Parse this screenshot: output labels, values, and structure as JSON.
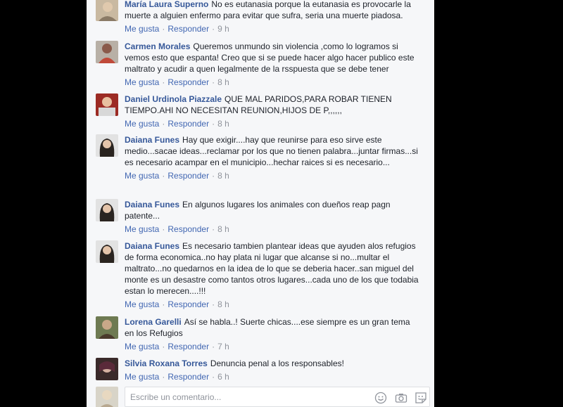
{
  "comments": [
    {
      "author": "María Laura Superno",
      "text": "No es eutanasia porque la eutanasia es provocarle la muerte a alguien enfermo para evitar que sufra, seria una muerte piadosa.",
      "like": "Me gusta",
      "reply": "Responder",
      "time": "9 h"
    },
    {
      "author": "Carmen Morales",
      "text": "Queremos unmundo sin violencia ,como lo logramos si vemos esto que espanta! Creo que si se puede hacer algo hacer publico este maltrato y acudir a quen legalmente de la rsspuesta que se debe tener",
      "like": "Me gusta",
      "reply": "Responder",
      "time": "8 h"
    },
    {
      "author": "Daniel Urdinola Piazzale",
      "text": "QUE MAL PARIDOS,PARA ROBAR TIENEN TIEMPO.AHI NO NECESITAN REUNION,HIJOS DE P,,,,,,",
      "like": "Me gusta",
      "reply": "Responder",
      "time": "8 h"
    },
    {
      "author": "Daiana Funes",
      "text": "Hay que exigir....hay que reunirse para eso sirve este medio...sacae ideas...reclamar por los que no tienen palabra...juntar firmas...si es necesario acampar en el municipio...hechar raices si es necesario...",
      "like": "Me gusta",
      "reply": "Responder",
      "time": "8 h"
    },
    {
      "author": "Daiana Funes",
      "text": "En algunos lugares los animales con dueños reap pagn patente...",
      "like": "Me gusta",
      "reply": "Responder",
      "time": "8 h"
    },
    {
      "author": "Daiana Funes",
      "text": "Es necesario tambien plantear ideas que ayuden alos refugios de forma economica..no hay plata ni lugar que alcanse si no...multar el maltrato...no quedarnos en la idea de lo que se deberia hacer..san miguel del monte es un desastre como tantos otros lugares...cada uno de los que todabia estan lo merecen....!!!",
      "like": "Me gusta",
      "reply": "Responder",
      "time": "8 h"
    },
    {
      "author": "Lorena Garelli",
      "text": "Así se habla..! Suerte chicas....ese siempre es un gran tema en los Refugios",
      "like": "Me gusta",
      "reply": "Responder",
      "time": "7 h"
    },
    {
      "author": "Silvia Roxana Torres",
      "text": "Denuncia penal a los responsables!",
      "like": "Me gusta",
      "reply": "Responder",
      "time": "6 h"
    }
  ],
  "composer": {
    "placeholder": "Escribe un comentario...",
    "icons": [
      "emoji-icon",
      "camera-icon",
      "sticker-icon"
    ]
  },
  "colors": {
    "author": "#365899",
    "link": "#4267b2",
    "meta": "#90949c",
    "panel": "#f6f7f9"
  }
}
